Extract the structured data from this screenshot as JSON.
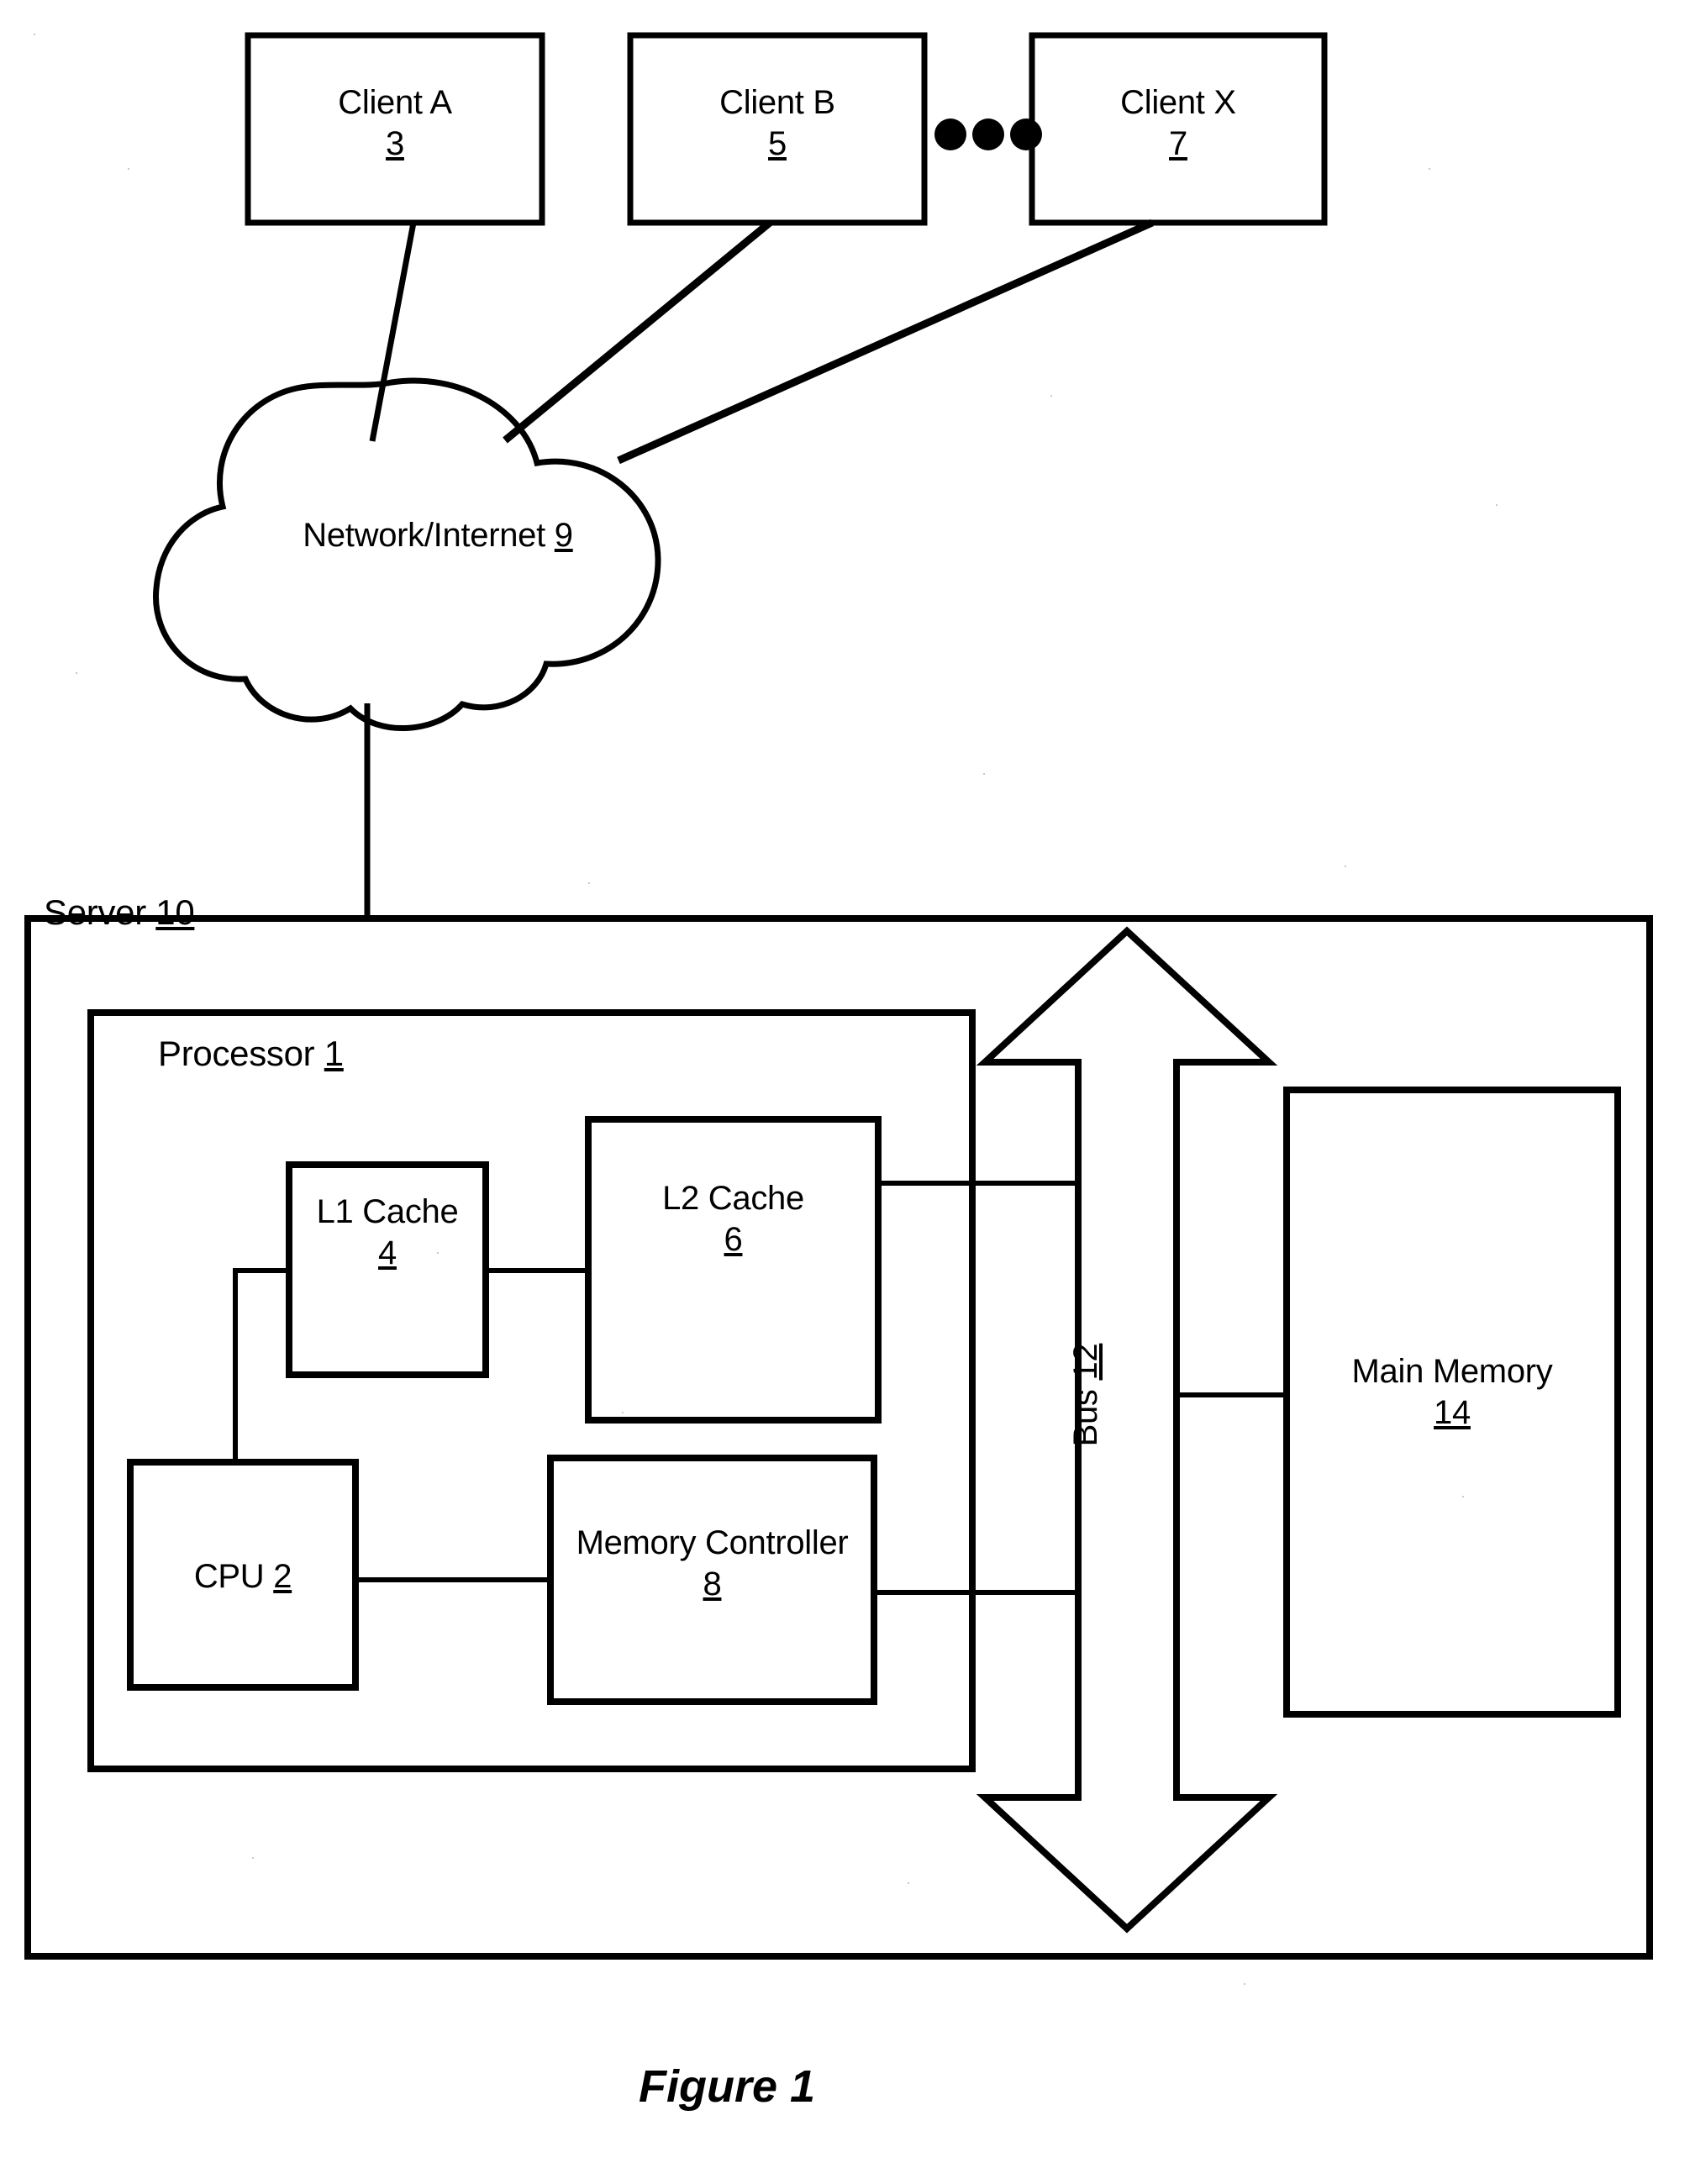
{
  "figure": {
    "caption": "Figure 1",
    "ink_color": "#000000",
    "background_color": "#ffffff"
  },
  "clients": [
    {
      "name": "Client A",
      "ref": "3"
    },
    {
      "name": "Client B",
      "ref": "5"
    },
    {
      "name": "Client X",
      "ref": "7"
    }
  ],
  "ellipsis": {
    "label": "...",
    "dots": 3
  },
  "network": {
    "label": "Network/Internet",
    "ref": "9"
  },
  "server": {
    "label": "Server",
    "ref": "10",
    "processor": {
      "label": "Processor",
      "ref": "1",
      "blocks": [
        {
          "name": "L1 Cache",
          "ref": "4"
        },
        {
          "name": "L2 Cache",
          "ref": "6"
        },
        {
          "name": "CPU",
          "ref": "2",
          "inline": true
        },
        {
          "name": "Memory Controller",
          "ref": "8"
        }
      ]
    },
    "bus": {
      "label": "Bus",
      "ref": "12",
      "orientation": "vertical",
      "arrow": "double-headed"
    },
    "main_memory": {
      "name": "Main Memory",
      "ref": "14"
    }
  }
}
